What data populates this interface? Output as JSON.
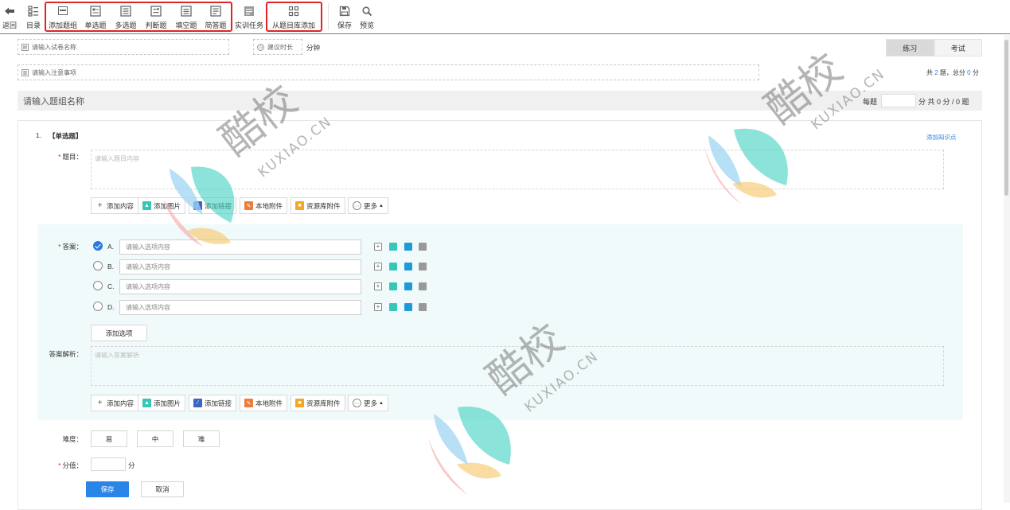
{
  "toolbar": {
    "back": "返回",
    "catalog": "目录",
    "add_group": "添加题组",
    "single_choice": "单选题",
    "multi_choice": "多选题",
    "true_false": "判断题",
    "fill_blank": "填空题",
    "short_answer": "简答题",
    "training_task": "实训任务",
    "from_bank": "从题目库添加",
    "save": "保存",
    "preview": "预览",
    "highlight_color": "#e02424"
  },
  "paper": {
    "name_placeholder": "请输入试卷名称",
    "duration_placeholder": "建议时长",
    "duration_unit": "分钟",
    "notes_placeholder": "请输入注意事项"
  },
  "mode_tabs": [
    {
      "label": "练习",
      "active": true
    },
    {
      "label": "考试",
      "active": false
    }
  ],
  "summary": {
    "prefix": "共",
    "count": "2",
    "mid": "题，总分",
    "total": "0",
    "suffix": "分"
  },
  "group": {
    "title_placeholder": "请输入题组名称",
    "per_question_label": "每题",
    "per_question_tail": "分 共 0 分 / 0 题"
  },
  "question": {
    "number": "1.",
    "type": "【单选题】",
    "add_knowledge": "添加知识点",
    "stem_label": "题目：",
    "stem_placeholder": "请输入题目内容",
    "answer_label": "答案：",
    "analysis_label": "答案解析：",
    "analysis_placeholder": "请输入答案解析",
    "options": [
      {
        "letter": "A.",
        "placeholder": "请输入选项内容",
        "checked": true
      },
      {
        "letter": "B.",
        "placeholder": "请输入选项内容",
        "checked": false
      },
      {
        "letter": "C.",
        "placeholder": "请输入选项内容",
        "checked": false
      },
      {
        "letter": "D.",
        "placeholder": "请输入选项内容",
        "checked": false
      }
    ],
    "add_option": "添加选项",
    "difficulty_label": "难度：",
    "difficulty": [
      "易",
      "中",
      "难"
    ],
    "score_label": "分值：",
    "score_unit": "分",
    "save": "保存",
    "cancel": "取消"
  },
  "editor_tools": {
    "add_content": "添加内容",
    "add_image": "添加图片",
    "add_link": "添加链接",
    "local_attachment": "本地附件",
    "resource_attachment": "资源库附件",
    "more": "更多"
  },
  "watermark": {
    "brand": "酷校",
    "domain": "KUXIAO.CN"
  },
  "colors": {
    "primary": "#2a85e8",
    "teal": "#38c6b8",
    "orange": "#f07c3a",
    "yellow": "#f5a623",
    "answer_bg": "#f1fafa"
  }
}
